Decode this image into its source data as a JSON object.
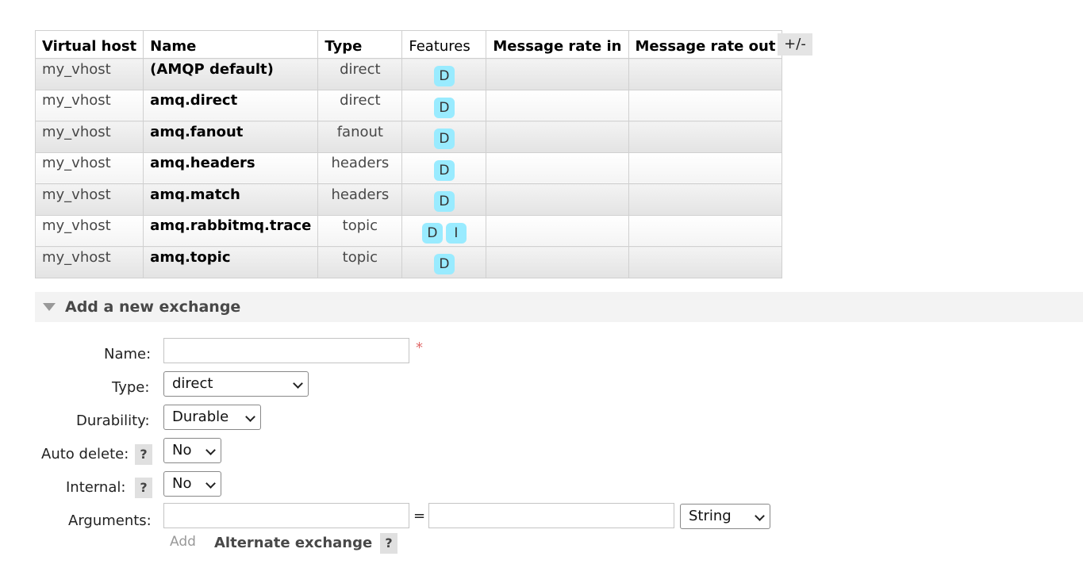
{
  "table": {
    "headers": {
      "vhost": "Virtual host",
      "name": "Name",
      "type": "Type",
      "features": "Features",
      "rate_in": "Message rate in",
      "rate_out": "Message rate out"
    },
    "columns_toggle": "+/-",
    "rows": [
      {
        "vhost": "my_vhost",
        "name": "(AMQP default)",
        "type": "direct",
        "features": [
          "D"
        ]
      },
      {
        "vhost": "my_vhost",
        "name": "amq.direct",
        "type": "direct",
        "features": [
          "D"
        ]
      },
      {
        "vhost": "my_vhost",
        "name": "amq.fanout",
        "type": "fanout",
        "features": [
          "D"
        ]
      },
      {
        "vhost": "my_vhost",
        "name": "amq.headers",
        "type": "headers",
        "features": [
          "D"
        ]
      },
      {
        "vhost": "my_vhost",
        "name": "amq.match",
        "type": "headers",
        "features": [
          "D"
        ]
      },
      {
        "vhost": "my_vhost",
        "name": "amq.rabbitmq.trace",
        "type": "topic",
        "features": [
          "D",
          "I"
        ]
      },
      {
        "vhost": "my_vhost",
        "name": "amq.topic",
        "type": "topic",
        "features": [
          "D"
        ]
      }
    ]
  },
  "add_section": {
    "title": "Add a new exchange",
    "name_label": "Name:",
    "name_value": "",
    "required_mark": "*",
    "type_label": "Type:",
    "type_value": "direct",
    "durability_label": "Durability:",
    "durability_value": "Durable",
    "auto_delete_label": "Auto delete:",
    "auto_delete_value": "No",
    "internal_label": "Internal:",
    "internal_value": "No",
    "arguments_label": "Arguments:",
    "arg_key_value": "",
    "arg_equals": "=",
    "arg_value_value": "",
    "arg_type_value": "String",
    "add_label": "Add",
    "alternate_exchange": "Alternate exchange",
    "help_mark": "?"
  },
  "colors": {
    "feature_badge": "#99ebff",
    "required": "#e06a6a"
  }
}
